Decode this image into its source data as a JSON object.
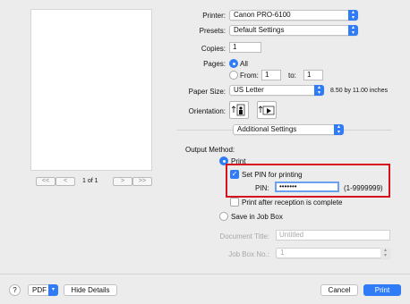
{
  "preview": {
    "page_indicator": "1 of 1",
    "first_label": "<<",
    "prev_label": "<",
    "next_label": ">",
    "last_label": ">>"
  },
  "printer": {
    "label": "Printer:",
    "value": "Canon PRO-6100"
  },
  "presets": {
    "label": "Presets:",
    "value": "Default Settings"
  },
  "copies": {
    "label": "Copies:",
    "value": "1"
  },
  "pages": {
    "label": "Pages:",
    "all_label": "All",
    "from_label": "From:",
    "from_value": "1",
    "to_label": "to:",
    "to_value": "1"
  },
  "paper_size": {
    "label": "Paper Size:",
    "value": "US Letter",
    "dimensions": "8.50 by 11.00 inches"
  },
  "orientation": {
    "label": "Orientation:"
  },
  "panel": {
    "value": "Additional Settings"
  },
  "output_method": {
    "label": "Output Method:",
    "print_label": "Print",
    "set_pin_label": "Set PIN for printing",
    "pin_label": "PIN:",
    "pin_value": "•••••••",
    "pin_range": "(1-9999999)",
    "print_after_label": "Print after reception is complete",
    "save_label": "Save in Job Box",
    "doc_title_label": "Document Title:",
    "doc_title_value": "Untitled",
    "job_box_label": "Job Box No.:",
    "job_box_value": "1"
  },
  "footer": {
    "help": "?",
    "pdf": "PDF",
    "hide_details": "Hide Details",
    "cancel": "Cancel",
    "print": "Print"
  },
  "colors": {
    "accent": "#2f7cf6",
    "highlight_box": "#d6121e"
  }
}
